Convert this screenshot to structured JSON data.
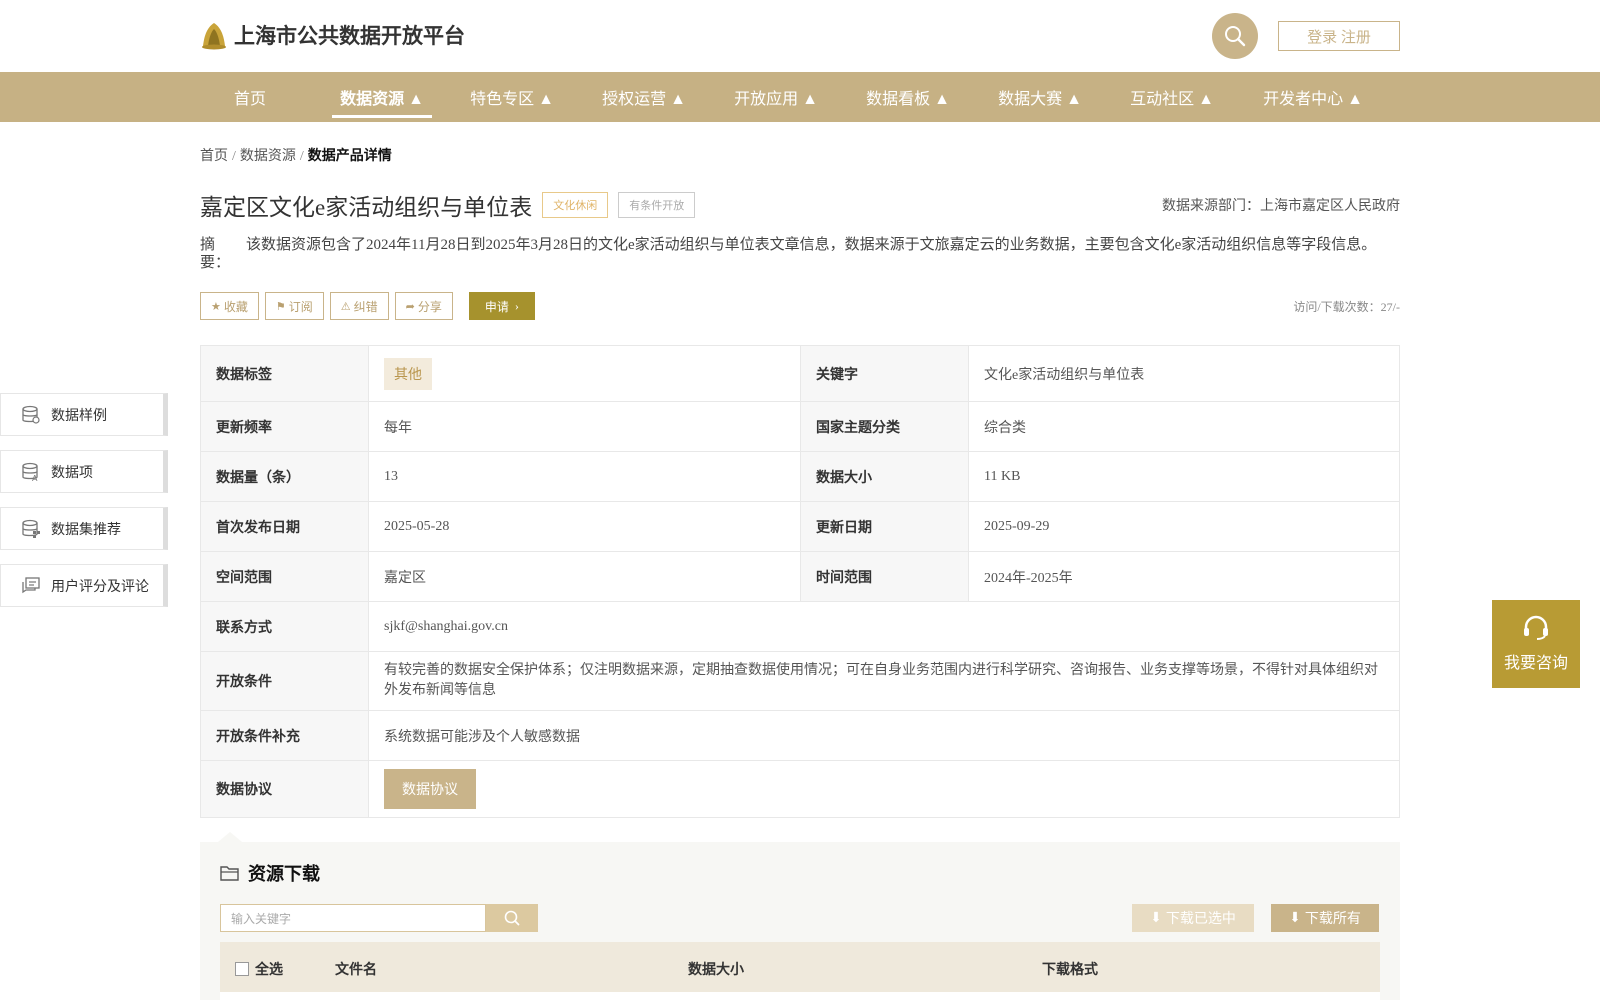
{
  "header": {
    "logo_text": "上海市公共数据开放平台",
    "login_label": "登录 注册"
  },
  "nav": [
    {
      "label": "首页"
    },
    {
      "label": "数据资源 ▲"
    },
    {
      "label": "特色专区 ▲"
    },
    {
      "label": "授权运营 ▲"
    },
    {
      "label": "开放应用 ▲"
    },
    {
      "label": "数据看板 ▲"
    },
    {
      "label": "数据大赛 ▲"
    },
    {
      "label": "互动社区 ▲"
    },
    {
      "label": "开发者中心 ▲"
    }
  ],
  "breadcrumb": {
    "home": "首页",
    "sep": "/",
    "resources": "数据资源",
    "current": "数据产品详情"
  },
  "product": {
    "title": "嘉定区文化e家活动组织与单位表",
    "tag_category": "文化休闲",
    "tag_open": "有条件开放",
    "source": "数据来源部门：上海市嘉定区人民政府",
    "summary_label": "摘 要：",
    "summary_text": "该数据资源包含了2024年11月28日到2025年3月28日的文化e家活动组织与单位表文章信息，数据来源于文旅嘉定云的业务数据，主要包含文化e家活动组织信息等字段信息。"
  },
  "actions": {
    "favorite": "收藏",
    "subscribe": "订阅",
    "report": "纠错",
    "share": "分享",
    "apply": "申请",
    "visits": "访问/下载次数：27/-"
  },
  "side_menu": [
    {
      "label": "数据样例"
    },
    {
      "label": "数据项"
    },
    {
      "label": "数据集推荐"
    },
    {
      "label": "用户评分及评论"
    }
  ],
  "info": {
    "tag_label": "数据标签",
    "tag_value": "其他",
    "keyword_label": "关键字",
    "keyword_value": "文化e家活动组织与单位表",
    "freq_label": "更新频率",
    "freq_value": "每年",
    "theme_label": "国家主题分类",
    "theme_value": "综合类",
    "count_label": "数据量（条）",
    "count_value": "13",
    "size_label": "数据大小",
    "size_value": "11 KB",
    "pub_label": "首次发布日期",
    "pub_value": "2025-05-28",
    "upd_label": "更新日期",
    "upd_value": "2025-09-29",
    "space_label": "空间范围",
    "space_value": "嘉定区",
    "time_label": "时间范围",
    "time_value": "2024年-2025年",
    "contact_label": "联系方式",
    "contact_value": "sjkf@shanghai.gov.cn",
    "cond_label": "开放条件",
    "cond_value": "有较完善的数据安全保护体系；仅注明数据来源，定期抽查数据使用情况；可在自身业务范围内进行科学研究、咨询报告、业务支撑等场景，不得针对具体组织对外发布新闻等信息",
    "cond2_label": "开放条件补充",
    "cond2_value": "系统数据可能涉及个人敏感数据",
    "agree_label": "数据协议",
    "agree_button": "数据协议"
  },
  "consult": {
    "label": "我要咨询"
  },
  "resource": {
    "title": "资源下载",
    "search_placeholder": "输入关键字",
    "download_selected": "下载已选中",
    "download_all": "下载所有",
    "col_select_all": "全选",
    "col_filename": "文件名",
    "col_size": "数据大小",
    "col_format": "下载格式"
  },
  "colors": {
    "brand": "#c6b184",
    "apply": "#a6922d",
    "consult": "#b89b34"
  }
}
